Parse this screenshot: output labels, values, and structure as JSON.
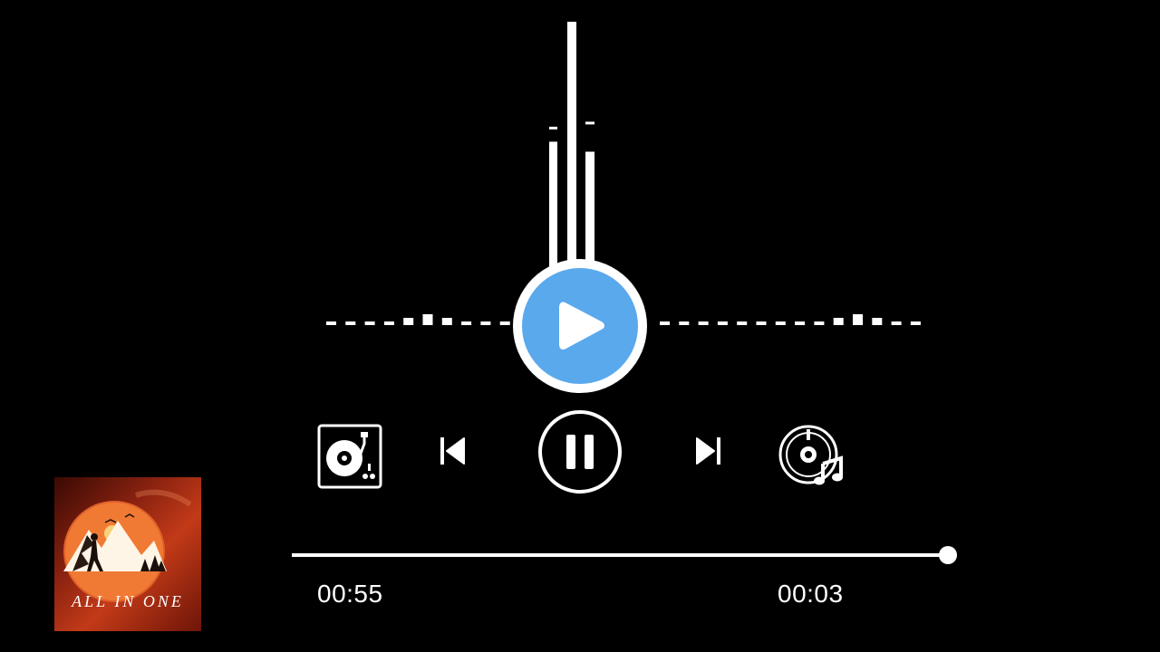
{
  "player": {
    "state": "playing",
    "elapsed": "00:55",
    "remaining": "00:03",
    "progress": 1.0
  },
  "album": {
    "cover_text": "ALL IN ONE"
  },
  "visualizer": {
    "horizontal_levels": [
      1,
      1,
      1,
      1,
      2,
      3,
      2,
      1,
      1,
      1,
      1,
      1,
      1,
      1,
      1,
      1,
      1,
      1,
      1,
      1,
      1,
      1,
      1,
      2,
      3,
      2,
      1,
      1
    ],
    "vertical_bars": [
      {
        "level": 0.52,
        "peak": 0.58
      },
      {
        "level": 1.0,
        "peak": 1.0
      },
      {
        "level": 0.48,
        "peak": 0.6
      }
    ]
  },
  "controls": {
    "items": [
      "turntable-icon",
      "skip-previous-icon",
      "pause-icon",
      "skip-next-icon",
      "music-disc-icon"
    ]
  },
  "colors": {
    "background": "#000000",
    "foreground": "#ffffff",
    "accent": "#5aa9ec"
  }
}
